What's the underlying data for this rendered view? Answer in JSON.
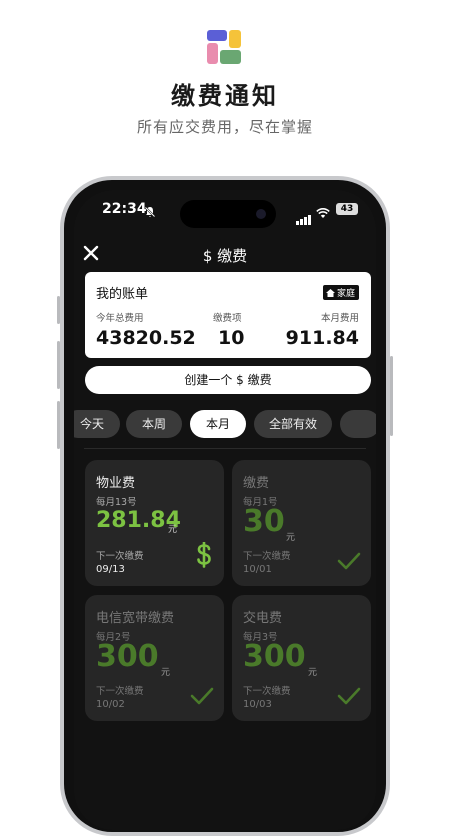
{
  "promo": {
    "title": "缴费通知",
    "subtitle": "所有应交费用，尽在掌握"
  },
  "status_bar": {
    "time": "22:34",
    "battery": "43"
  },
  "nav": {
    "title": "$ 缴费"
  },
  "account": {
    "title": "我的账单",
    "tag": "家庭",
    "stats": [
      {
        "label": "今年总费用",
        "value": "43820.52"
      },
      {
        "label": "缴费项",
        "value": "10"
      },
      {
        "label": "本月费用",
        "value": "911.84"
      }
    ]
  },
  "create_button": {
    "label": "创建一个 $ 缴费"
  },
  "filters": [
    {
      "label": "今天",
      "active": false
    },
    {
      "label": "本周",
      "active": false
    },
    {
      "label": "本月",
      "active": true
    },
    {
      "label": "全部有效",
      "active": false
    }
  ],
  "bills": [
    {
      "name": "物业费",
      "cycle": "每月13号",
      "amount": "281.84",
      "unit": "元",
      "next_label": "下一次缴费",
      "next_date": "09/13",
      "paid": false
    },
    {
      "name": "缴费",
      "cycle": "每月1号",
      "amount": "30",
      "unit": "元",
      "next_label": "下一次缴费",
      "next_date": "10/01",
      "paid": true
    },
    {
      "name": "电信宽带缴费",
      "cycle": "每月2号",
      "amount": "300",
      "unit": "元",
      "next_label": "下一次缴费",
      "next_date": "10/02",
      "paid": true
    },
    {
      "name": "交电费",
      "cycle": "每月3号",
      "amount": "300",
      "unit": "元",
      "next_label": "下一次缴费",
      "next_date": "10/03",
      "paid": true
    }
  ],
  "colors": {
    "accent_green": "#7cc242",
    "dim_green": "#4a7a2a",
    "card_bg": "#262626"
  }
}
